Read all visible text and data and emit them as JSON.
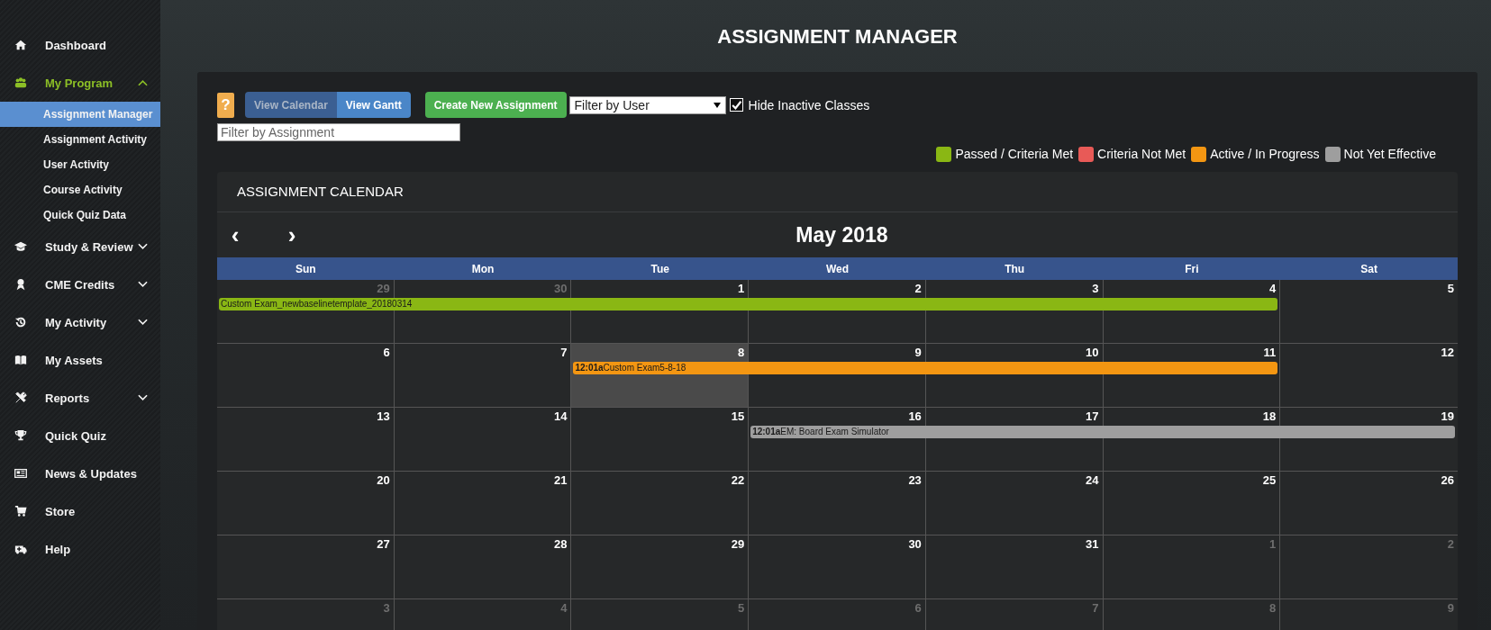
{
  "sidebar": {
    "items": [
      {
        "label": "Dashboard",
        "kind": "link",
        "selected": false
      },
      {
        "label": "My Program",
        "kind": "group",
        "selected": true,
        "expanded": true,
        "children": [
          {
            "label": "Assignment Manager",
            "selected": true
          },
          {
            "label": "Assignment Activity",
            "selected": false
          },
          {
            "label": "User Activity",
            "selected": false
          },
          {
            "label": "Course Activity",
            "selected": false
          },
          {
            "label": "Quick Quiz Data",
            "selected": false
          }
        ]
      },
      {
        "label": "Study & Review",
        "kind": "group",
        "selected": false,
        "expanded": false
      },
      {
        "label": "CME Credits",
        "kind": "group",
        "selected": false,
        "expanded": false
      },
      {
        "label": "My Activity",
        "kind": "group",
        "selected": false,
        "expanded": false
      },
      {
        "label": "My Assets",
        "kind": "link",
        "selected": false
      },
      {
        "label": "Reports",
        "kind": "group",
        "selected": false,
        "expanded": false
      },
      {
        "label": "Quick Quiz",
        "kind": "link",
        "selected": false
      },
      {
        "label": "News & Updates",
        "kind": "link",
        "selected": false
      },
      {
        "label": "Store",
        "kind": "link",
        "selected": false
      },
      {
        "label": "Help",
        "kind": "link",
        "selected": false
      }
    ]
  },
  "page_title": "ASSIGNMENT MANAGER",
  "toolbar": {
    "help_button": "?",
    "view_toggle": [
      {
        "label": "View Calendar",
        "selected": true
      },
      {
        "label": "View Gantt",
        "selected": false
      }
    ],
    "create_button": "Create New Assignment",
    "user_filter": {
      "value": "Filter by User"
    },
    "hide_inactive": {
      "label": "Hide Inactive Classes",
      "checked": true
    },
    "assignment_filter": {
      "placeholder": "Filter by Assignment"
    }
  },
  "legend": [
    {
      "label": "Passed / Criteria Met",
      "color": "#8ab714"
    },
    {
      "label": "Criteria Not Met",
      "color": "#e85a57"
    },
    {
      "label": "Active / In Progress",
      "color": "#f39612"
    },
    {
      "label": "Not Yet Effective",
      "color": "#9e9e9e"
    }
  ],
  "calendar": {
    "panel_title": "ASSIGNMENT CALENDAR",
    "prev": "‹",
    "next": "›",
    "month": "May 2018",
    "weekdays": [
      "Sun",
      "Mon",
      "Tue",
      "Wed",
      "Thu",
      "Fri",
      "Sat"
    ],
    "weeks": [
      {
        "segments": [
          {
            "event": {
              "title": "Custom Exam_newbaselinetemplate_20180314",
              "color": "#8ab714"
            },
            "days": [
              {
                "date": "29",
                "other_month": true,
                "today": false
              },
              {
                "date": "30",
                "other_month": true,
                "today": false
              },
              {
                "date": "1",
                "other_month": false,
                "today": false
              },
              {
                "date": "2",
                "other_month": false,
                "today": false
              },
              {
                "date": "3",
                "other_month": false,
                "today": false
              },
              {
                "date": "4",
                "other_month": false,
                "today": false
              }
            ]
          },
          {
            "days": [
              {
                "date": "5",
                "other_month": false,
                "today": false
              }
            ]
          }
        ]
      },
      {
        "segments": [
          {
            "days": [
              {
                "date": "6",
                "other_month": false,
                "today": false
              },
              {
                "date": "7",
                "other_month": false,
                "today": false
              }
            ]
          },
          {
            "event": {
              "time": "12:01a",
              "title": "Custom Exam5-8-18",
              "color": "#f39612"
            },
            "days": [
              {
                "date": "8",
                "other_month": false,
                "today": true
              },
              {
                "date": "9",
                "other_month": false,
                "today": false
              },
              {
                "date": "10",
                "other_month": false,
                "today": false
              },
              {
                "date": "11",
                "other_month": false,
                "today": false
              }
            ]
          },
          {
            "days": [
              {
                "date": "12",
                "other_month": false,
                "today": false
              }
            ]
          }
        ]
      },
      {
        "segments": [
          {
            "days": [
              {
                "date": "13",
                "other_month": false,
                "today": false
              },
              {
                "date": "14",
                "other_month": false,
                "today": false
              },
              {
                "date": "15",
                "other_month": false,
                "today": false
              }
            ]
          },
          {
            "event": {
              "time": "12:01a",
              "title": "EM: Board Exam Simulator",
              "color": "#9e9e9e"
            },
            "days": [
              {
                "date": "16",
                "other_month": false,
                "today": false
              },
              {
                "date": "17",
                "other_month": false,
                "today": false
              },
              {
                "date": "18",
                "other_month": false,
                "today": false
              },
              {
                "date": "19",
                "other_month": false,
                "today": false
              }
            ]
          }
        ]
      },
      {
        "segments": [
          {
            "days": [
              {
                "date": "20",
                "other_month": false,
                "today": false
              },
              {
                "date": "21",
                "other_month": false,
                "today": false
              },
              {
                "date": "22",
                "other_month": false,
                "today": false
              },
              {
                "date": "23",
                "other_month": false,
                "today": false
              },
              {
                "date": "24",
                "other_month": false,
                "today": false
              },
              {
                "date": "25",
                "other_month": false,
                "today": false
              },
              {
                "date": "26",
                "other_month": false,
                "today": false
              }
            ]
          }
        ]
      },
      {
        "segments": [
          {
            "days": [
              {
                "date": "27",
                "other_month": false,
                "today": false
              },
              {
                "date": "28",
                "other_month": false,
                "today": false
              },
              {
                "date": "29",
                "other_month": false,
                "today": false
              },
              {
                "date": "30",
                "other_month": false,
                "today": false
              },
              {
                "date": "31",
                "other_month": false,
                "today": false
              },
              {
                "date": "1",
                "other_month": true,
                "today": false
              },
              {
                "date": "2",
                "other_month": true,
                "today": false
              }
            ]
          }
        ]
      },
      {
        "segments": [
          {
            "days": [
              {
                "date": "3",
                "other_month": true,
                "today": false
              },
              {
                "date": "4",
                "other_month": true,
                "today": false
              },
              {
                "date": "5",
                "other_month": true,
                "today": false
              },
              {
                "date": "6",
                "other_month": true,
                "today": false
              },
              {
                "date": "7",
                "other_month": true,
                "today": false
              },
              {
                "date": "8",
                "other_month": true,
                "today": false
              },
              {
                "date": "9",
                "other_month": true,
                "today": false
              }
            ]
          }
        ]
      }
    ]
  }
}
